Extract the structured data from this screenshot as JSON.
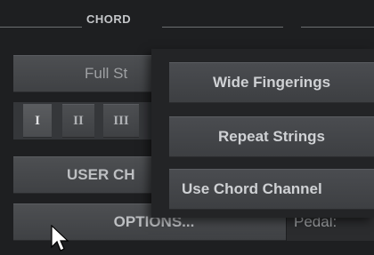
{
  "chord_section": {
    "title": "CHORD",
    "strum_mode_button": "Full St",
    "inversion_buttons": [
      "I",
      "II",
      "III"
    ],
    "user_chord_button": "USER CH",
    "options_button": "OPTIONS..."
  },
  "right_panel": {
    "pedal_label": "Pedal:"
  },
  "options_menu": {
    "items": [
      "Wide Fingerings",
      "Repeat Strings",
      "Use Chord Channel"
    ]
  },
  "colors": {
    "background": "#1e1f21",
    "button": "#46484b",
    "menu_bg": "#232426",
    "text": "#cfd1d4"
  },
  "cursor": "arrow-pointer-icon"
}
